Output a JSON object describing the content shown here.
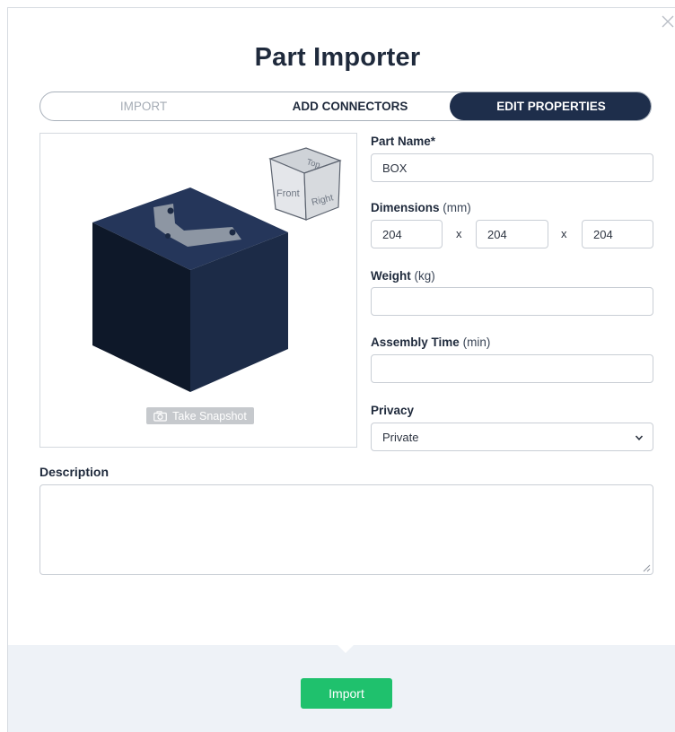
{
  "title": "Part Importer",
  "steps": [
    {
      "label": "IMPORT",
      "state": "done"
    },
    {
      "label": "ADD CONNECTORS",
      "state": "done"
    },
    {
      "label": "EDIT PROPERTIES",
      "state": "active"
    }
  ],
  "preview": {
    "snapshot_label": "Take Snapshot",
    "nav_cube_faces": {
      "top": "Top",
      "front": "Front",
      "right": "Right"
    }
  },
  "fields": {
    "part_name": {
      "label": "Part Name*",
      "value": "BOX"
    },
    "dimensions": {
      "label": "Dimensions",
      "unit": "(mm)",
      "values": [
        "204",
        "204",
        "204"
      ],
      "separator": "x"
    },
    "weight": {
      "label": "Weight",
      "unit": "(kg)",
      "value": ""
    },
    "assembly_time": {
      "label": "Assembly Time",
      "unit": "(min)",
      "value": ""
    },
    "privacy": {
      "label": "Privacy",
      "value": "Private"
    }
  },
  "description": {
    "label": "Description",
    "value": ""
  },
  "footer": {
    "import_label": "Import"
  },
  "colors": {
    "navy": "#1e2e4b",
    "accent_green": "#1fc16d",
    "box_dark": "#1c2a44",
    "footer_bg": "#eef2f7"
  }
}
